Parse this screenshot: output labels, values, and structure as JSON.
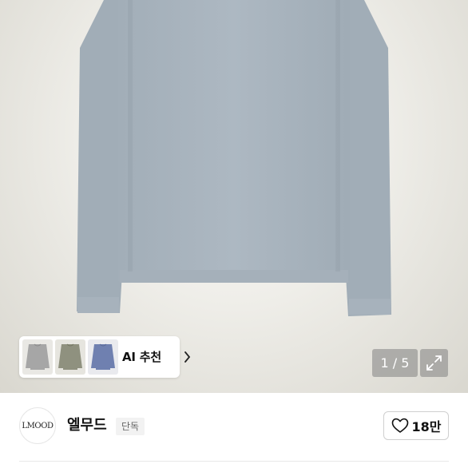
{
  "gallery": {
    "product_image": "knit-sweater-light-blue",
    "page_indicator": "1 / 5",
    "ai_recommend": {
      "label": "AI 추천",
      "thumbnails": [
        "grey-sweater-thumbnail",
        "khaki-sweater-thumbnail",
        "blue-sweater-thumbnail"
      ]
    },
    "expand_icon": "expand-icon"
  },
  "brand": {
    "logo_text": "LMOOD",
    "name": "엘무드",
    "badge": "단독"
  },
  "like": {
    "icon": "heart-icon",
    "count": "18만"
  },
  "colors": {
    "sweater": "#a9b4be",
    "badge_bg": "#f2f2f2",
    "overlay": "#828282"
  }
}
